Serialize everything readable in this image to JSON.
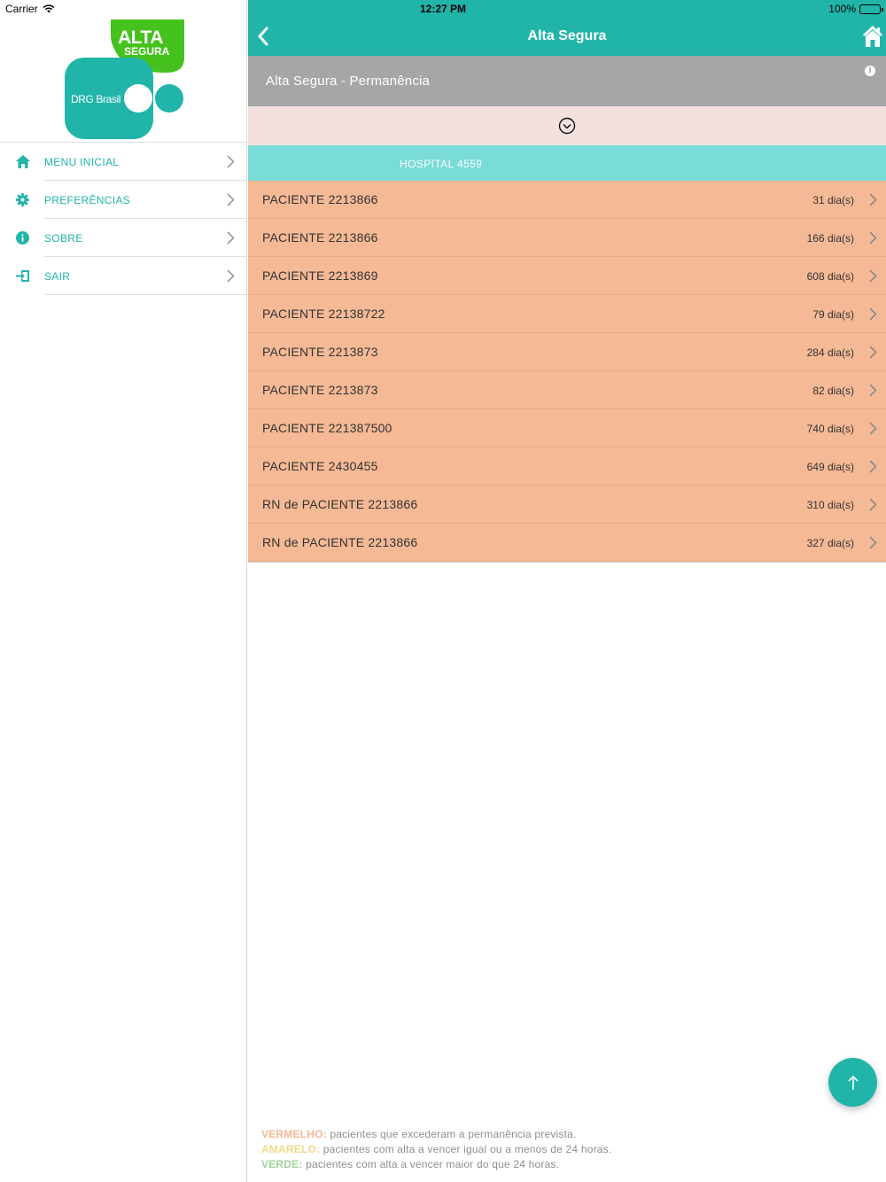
{
  "status_bar": {
    "carrier": "Carrier",
    "time": "12:27 PM",
    "battery": "100%"
  },
  "logo": {
    "top_text": "ALTA",
    "top_subtext": "SEGURA",
    "brand_text": "DRG Brasil",
    "colors": {
      "green": "#45c21d",
      "teal": "#21b5aa"
    }
  },
  "sidebar": {
    "items": [
      {
        "label": "MENU INICIAL",
        "icon": "home-icon"
      },
      {
        "label": "PREFERÊNCIAS",
        "icon": "gear-icon"
      },
      {
        "label": "SOBRE",
        "icon": "info-icon"
      },
      {
        "label": "SAIR",
        "icon": "logout-icon"
      }
    ]
  },
  "navbar": {
    "title": "Alta Segura",
    "back_icon": "chevron-left-icon",
    "home_icon": "home-icon"
  },
  "subheader": {
    "title": "Alta Segura - Permanência",
    "info_icon": "info-icon"
  },
  "expander": {
    "icon": "chevron-down-circle-icon"
  },
  "hospital": {
    "label": "HOSPITAL 4559"
  },
  "patients": [
    {
      "name": "PACIENTE 2213866",
      "days": "31 dia(s)"
    },
    {
      "name": "PACIENTE 2213866",
      "days": "166 dia(s)"
    },
    {
      "name": "PACIENTE 2213869",
      "days": "608 dia(s)"
    },
    {
      "name": "PACIENTE 22138722",
      "days": "79 dia(s)"
    },
    {
      "name": "PACIENTE 2213873",
      "days": "284 dia(s)"
    },
    {
      "name": "PACIENTE 2213873",
      "days": "82 dia(s)"
    },
    {
      "name": "PACIENTE 221387500",
      "days": "740 dia(s)"
    },
    {
      "name": "PACIENTE 2430455",
      "days": "649 dia(s)"
    },
    {
      "name": "RN de PACIENTE 2213866",
      "days": "310 dia(s)"
    },
    {
      "name": "RN de PACIENTE 2213866",
      "days": "327 dia(s)"
    }
  ],
  "fab": {
    "icon": "arrow-up-icon"
  },
  "legend": {
    "red": {
      "key": "VERMELHO:",
      "text": " pacientes que excederam a permanência prevista.",
      "color": "#f5b996"
    },
    "yellow": {
      "key": "AMARELO:",
      "text": " pacientes com alta a vencer igual ou a menos de 24 horas.",
      "color": "#f2d78a"
    },
    "green": {
      "key": "VERDE:",
      "text": " pacientes com alta a vencer maior do que 24 horas.",
      "color": "#9fd39a"
    }
  },
  "colors": {
    "accent": "#21b5aa",
    "subheader_bg": "#a6a6a9",
    "expander_bg": "#f3e0df",
    "hospital_bg": "#7adcd6",
    "patient_row_bg": "#f5b996"
  }
}
